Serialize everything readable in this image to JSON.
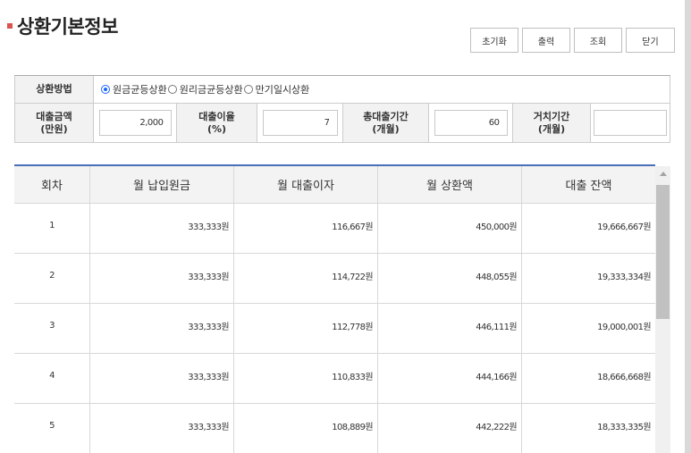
{
  "header": {
    "title": "상환기본정보",
    "buttons": [
      "초기화",
      "출력",
      "조회",
      "닫기"
    ]
  },
  "form": {
    "method_label": "상환방법",
    "methods": [
      {
        "label": "원금균등상환",
        "selected": true
      },
      {
        "label": "원리금균등상환",
        "selected": false
      },
      {
        "label": "만기일시상환",
        "selected": false
      }
    ],
    "fields": [
      {
        "label_line1": "대출금액",
        "label_line2": "(만원)",
        "value": "2,000"
      },
      {
        "label_line1": "대출이율",
        "label_line2": "(%)",
        "value": "7"
      },
      {
        "label_line1": "총대출기간",
        "label_line2": "(개월)",
        "value": "60"
      },
      {
        "label_line1": "거치기간",
        "label_line2": "(개월)",
        "value": ""
      }
    ]
  },
  "schedule": {
    "columns": [
      "회차",
      "월 납입원금",
      "월 대출이자",
      "월 상환액",
      "대출 잔액"
    ],
    "rows": [
      [
        "1",
        "333,333원",
        "116,667원",
        "450,000원",
        "19,666,667원"
      ],
      [
        "2",
        "333,333원",
        "114,722원",
        "448,055원",
        "19,333,334원"
      ],
      [
        "3",
        "333,333원",
        "112,778원",
        "446,111원",
        "19,000,001원"
      ],
      [
        "4",
        "333,333원",
        "110,833원",
        "444,166원",
        "18,666,668원"
      ],
      [
        "5",
        "333,333원",
        "108,889원",
        "442,222원",
        "18,333,335원"
      ]
    ]
  },
  "colors": {
    "accent_marker": "#d9534f",
    "radio_selected": "#1a66ff",
    "table_top_border": "#4a6fb8"
  }
}
